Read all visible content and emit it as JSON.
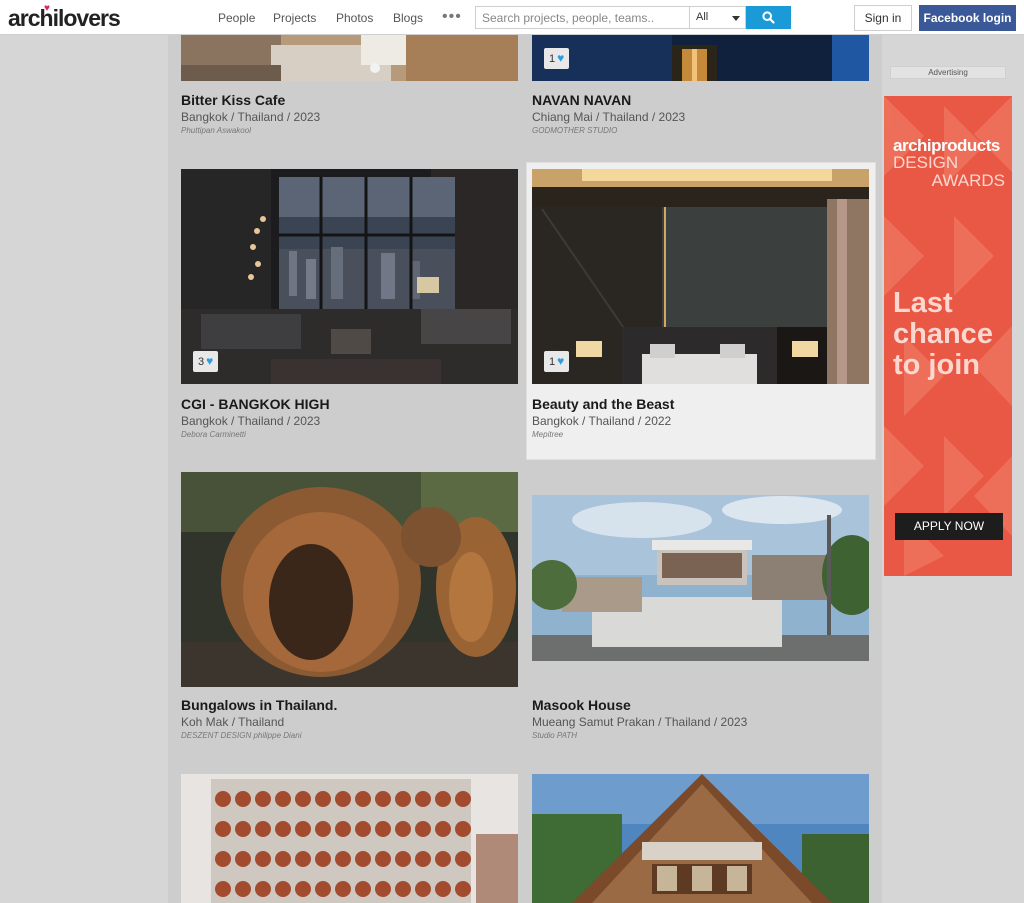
{
  "header": {
    "logo_text": "archilovers",
    "nav": [
      "People",
      "Projects",
      "Photos",
      "Blogs"
    ],
    "more": "•••",
    "search_placeholder": "Search projects, people, teams..",
    "search_scope": "All",
    "sign_in": "Sign in",
    "facebook_login": "Facebook login"
  },
  "cards": [
    {
      "title": "Bitter Kiss Cafe",
      "location": "Bangkok / Thailand / 2023",
      "author": "Phuttipan Aswakool"
    },
    {
      "title": "NAVAN NAVAN",
      "location": "Chiang Mai / Thailand / 2023",
      "author": "GODMOTHER STUDIO",
      "likes": "1"
    },
    {
      "title": "CGI - BANGKOK HIGH",
      "location": "Bangkok / Thailand / 2023",
      "author": "Debora Carminetti",
      "likes": "3"
    },
    {
      "title": "Beauty and the Beast",
      "location": "Bangkok / Thailand / 2022",
      "author": "Mepitree",
      "likes": "1"
    },
    {
      "title": "Bungalows in Thailand.",
      "location": "Koh Mak / Thailand",
      "author": "DESZENT DESIGN philippe Diani"
    },
    {
      "title": "Masook House",
      "location": "Mueang Samut Prakan / Thailand / 2023",
      "author": "Studio PATH"
    },
    {
      "title": "",
      "location": "",
      "author": ""
    },
    {
      "title": "",
      "location": "",
      "author": ""
    }
  ],
  "sidebar": {
    "advertising_label": "Advertising",
    "ad": {
      "brand": "archiproducts",
      "line1": "DESIGN",
      "line2": "AWARDS",
      "headline": [
        "Last",
        "chance",
        "to join"
      ],
      "cta": "APPLY NOW"
    }
  },
  "colors": {
    "accent": "#1b9ad8",
    "facebook": "#3b5998",
    "ad_background": "#e95844",
    "heart": "#2c9ee0"
  }
}
